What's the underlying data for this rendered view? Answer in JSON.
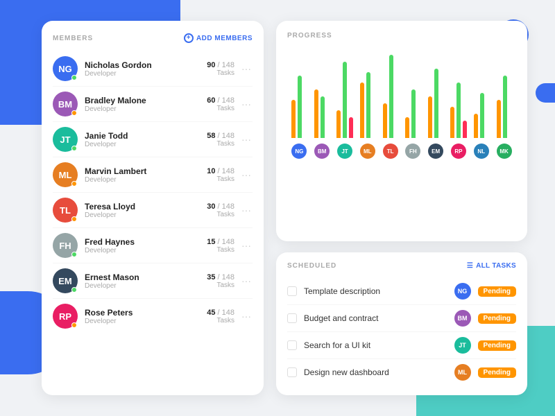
{
  "background": {
    "desc": "decorative background shapes"
  },
  "members_panel": {
    "title": "MEMBERS",
    "add_button": "ADD MEMBERS",
    "members": [
      {
        "name": "Nicholas Gordon",
        "role": "Developer",
        "current": "90",
        "total": "148",
        "status": "green",
        "initials": "NG",
        "color": "av-blue"
      },
      {
        "name": "Bradley Malone",
        "role": "Developer",
        "current": "60",
        "total": "148",
        "status": "orange",
        "initials": "BM",
        "color": "av-purple"
      },
      {
        "name": "Janie Todd",
        "role": "Developer",
        "current": "58",
        "total": "148",
        "status": "green",
        "initials": "JT",
        "color": "av-teal"
      },
      {
        "name": "Marvin Lambert",
        "role": "Developer",
        "current": "10",
        "total": "148",
        "status": "orange",
        "initials": "ML",
        "color": "av-orange"
      },
      {
        "name": "Teresa Lloyd",
        "role": "Developer",
        "current": "30",
        "total": "148",
        "status": "orange",
        "initials": "TL",
        "color": "av-red"
      },
      {
        "name": "Fred Haynes",
        "role": "Developer",
        "current": "15",
        "total": "148",
        "status": "green",
        "initials": "FH",
        "color": "av-gray"
      },
      {
        "name": "Ernest Mason",
        "role": "Developer",
        "current": "35",
        "total": "148",
        "status": "green",
        "initials": "EM",
        "color": "av-dark"
      },
      {
        "name": "Rose Peters",
        "role": "Developer",
        "current": "45",
        "total": "148",
        "status": "orange",
        "initials": "RP",
        "color": "av-pink"
      }
    ]
  },
  "progress_panel": {
    "title": "PROGRESS",
    "bars": [
      {
        "orange": 55,
        "green": 90
      },
      {
        "orange": 70,
        "green": 60
      },
      {
        "orange": 40,
        "green": 110,
        "pink": 30
      },
      {
        "orange": 80,
        "green": 95
      },
      {
        "orange": 50,
        "green": 120
      },
      {
        "orange": 30,
        "green": 70
      },
      {
        "orange": 60,
        "green": 100
      },
      {
        "orange": 45,
        "green": 80,
        "pink": 25
      },
      {
        "orange": 35,
        "green": 65
      },
      {
        "orange": 55,
        "green": 90
      }
    ],
    "avatars": [
      {
        "initials": "NG",
        "color": "av-blue"
      },
      {
        "initials": "BM",
        "color": "av-purple"
      },
      {
        "initials": "JT",
        "color": "av-teal"
      },
      {
        "initials": "ML",
        "color": "av-orange"
      },
      {
        "initials": "TL",
        "color": "av-red"
      },
      {
        "initials": "FH",
        "color": "av-gray"
      },
      {
        "initials": "EM",
        "color": "av-dark"
      },
      {
        "initials": "RP",
        "color": "av-pink"
      },
      {
        "initials": "NL",
        "color": "av-light-blue"
      },
      {
        "initials": "MK",
        "color": "av-green"
      }
    ]
  },
  "scheduled_panel": {
    "title": "SCHEDULED",
    "all_tasks_label": "ALL TASKS",
    "tasks": [
      {
        "name": "Template description",
        "assignee": "NG",
        "assignee_color": "av-blue",
        "status": "Pending"
      },
      {
        "name": "Budget and contract",
        "assignee": "BM",
        "assignee_color": "av-purple",
        "status": "Pending"
      },
      {
        "name": "Search for a UI kit",
        "assignee": "JT",
        "assignee_color": "av-teal",
        "status": "Pending"
      },
      {
        "name": "Design new dashboard",
        "assignee": "ML",
        "assignee_color": "av-orange",
        "status": "Pending"
      }
    ]
  }
}
